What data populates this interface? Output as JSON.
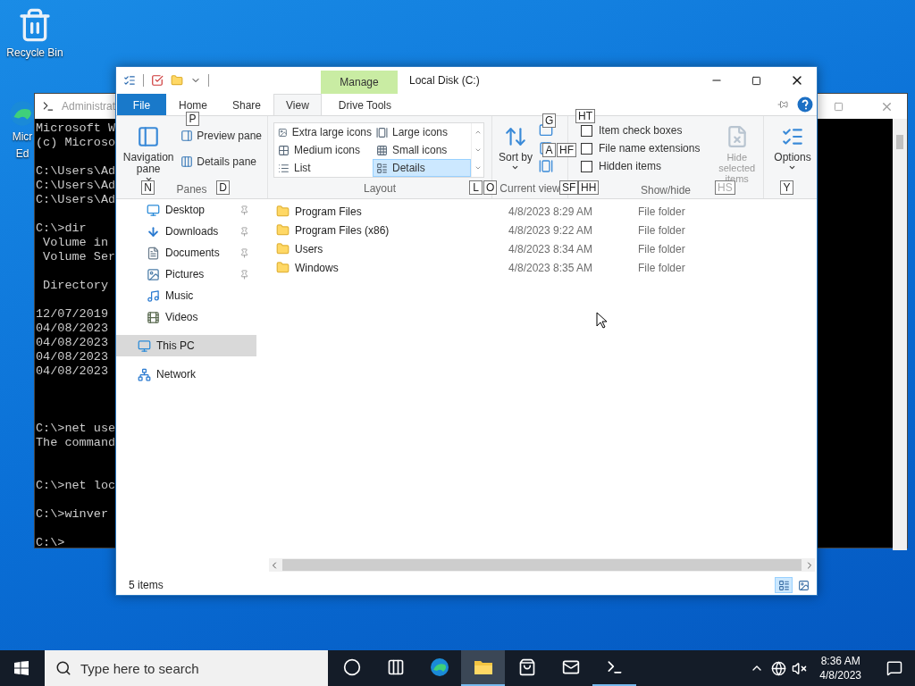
{
  "desktop_icons": [
    {
      "kind": "recycle_bin",
      "label_lines": [
        "Recycle Bin"
      ]
    },
    {
      "kind": "browser",
      "label_lines": [
        "Micr",
        "Ed"
      ]
    }
  ],
  "console_window": {
    "title": "Administrat",
    "output": "Microsoft W\n(c) Microso\n\nC:\\Users\\Ad\nC:\\Users\\Ad\nC:\\Users\\Ad\n\nC:\\>dir\n Volume in\n Volume Ser\n\n Directory\n\n12/07/2019\n04/08/2023\n04/08/2023\n04/08/2023\n04/08/2023\n\n\n\nC:\\>net use\nThe command\n\n\nC:\\>net loc\n\nC:\\>winver\n\nC:\\>"
  },
  "explorer": {
    "contextual_tab": "Manage",
    "title": "Local Disk (C:)",
    "ribbon_tabs": [
      {
        "label": "File",
        "kind": "file",
        "selected": false
      },
      {
        "label": "Home",
        "kind": "tab",
        "selected": false
      },
      {
        "label": "Share",
        "kind": "tab",
        "selected": false
      },
      {
        "label": "View",
        "kind": "tab",
        "selected": true
      },
      {
        "label": "Drive Tools",
        "kind": "contextual",
        "selected": false
      }
    ],
    "panes": {
      "label": "Panes",
      "navigation_pane": "Navigation pane",
      "buttons": [
        "Preview pane",
        "Details pane"
      ]
    },
    "layout": {
      "label": "Layout",
      "options": [
        {
          "label": "Extra large icons",
          "kind": "xl",
          "selected": false
        },
        {
          "label": "Large icons",
          "kind": "large",
          "selected": false
        },
        {
          "label": "Medium icons",
          "kind": "medium",
          "selected": false
        },
        {
          "label": "Small icons",
          "kind": "small",
          "selected": false
        },
        {
          "label": "List",
          "kind": "list",
          "selected": false
        },
        {
          "label": "Details",
          "kind": "details",
          "selected": true
        }
      ]
    },
    "current_view": {
      "label": "Current view",
      "sort_by": "Sort by"
    },
    "show_hide": {
      "label": "Show/hide",
      "checkboxes": [
        {
          "label": "Item check boxes",
          "checked": false
        },
        {
          "label": "File name extensions",
          "checked": false
        },
        {
          "label": "Hidden items",
          "checked": false
        }
      ],
      "hide_selected": {
        "label": "Hide selected items",
        "disabled": true
      }
    },
    "options": {
      "label": "Options"
    },
    "key_tips": [
      {
        "label": "P",
        "disabled": false
      },
      {
        "label": "N",
        "disabled": false
      },
      {
        "label": "D",
        "disabled": false
      },
      {
        "label": "L",
        "disabled": false
      },
      {
        "label": "G",
        "disabled": false
      },
      {
        "label": "O",
        "disabled": false
      },
      {
        "label": "A",
        "disabled": false
      },
      {
        "label": "SF",
        "disabled": false
      },
      {
        "label": "HT",
        "disabled": false
      },
      {
        "label": "HF",
        "disabled": false
      },
      {
        "label": "HH",
        "disabled": false
      },
      {
        "label": "HS",
        "disabled": true
      },
      {
        "label": "Y",
        "disabled": false
      }
    ],
    "navigation": [
      {
        "label": "Desktop",
        "kind": "desktop",
        "pinned": true,
        "selected": false
      },
      {
        "label": "Downloads",
        "kind": "downloads",
        "pinned": true,
        "selected": false
      },
      {
        "label": "Documents",
        "kind": "documents",
        "pinned": true,
        "selected": false
      },
      {
        "label": "Pictures",
        "kind": "pictures",
        "pinned": true,
        "selected": false
      },
      {
        "label": "Music",
        "kind": "music",
        "pinned": false,
        "selected": false
      },
      {
        "label": "Videos",
        "kind": "videos",
        "pinned": false,
        "selected": false
      },
      {
        "label": "This PC",
        "kind": "pc",
        "pinned": false,
        "selected": true
      },
      {
        "label": "Network",
        "kind": "network",
        "pinned": false,
        "selected": false
      }
    ],
    "files": [
      {
        "name": "Program Files",
        "date_modified": "4/8/2023 8:29 AM",
        "type": "File folder"
      },
      {
        "name": "Program Files (x86)",
        "date_modified": "4/8/2023 9:22 AM",
        "type": "File folder"
      },
      {
        "name": "Users",
        "date_modified": "4/8/2023 8:34 AM",
        "type": "File folder"
      },
      {
        "name": "Windows",
        "date_modified": "4/8/2023 8:35 AM",
        "type": "File folder"
      }
    ],
    "status": "5 items",
    "view_buttons": [
      {
        "kind": "details",
        "selected": true
      },
      {
        "kind": "large_icons",
        "selected": false
      }
    ]
  },
  "taskbar": {
    "search_placeholder": "Type here to search",
    "apps": [
      {
        "kind": "circle",
        "selected": false,
        "running": false
      },
      {
        "kind": "task_view",
        "selected": false,
        "running": false
      },
      {
        "kind": "browser",
        "selected": false,
        "running": false
      },
      {
        "kind": "folder",
        "selected": true,
        "running": true
      },
      {
        "kind": "store",
        "selected": false,
        "running": false
      },
      {
        "kind": "mail",
        "selected": false,
        "running": false
      },
      {
        "kind": "terminal",
        "selected": false,
        "running": true
      }
    ],
    "time": "8:36 AM",
    "date": "4/8/2023"
  }
}
